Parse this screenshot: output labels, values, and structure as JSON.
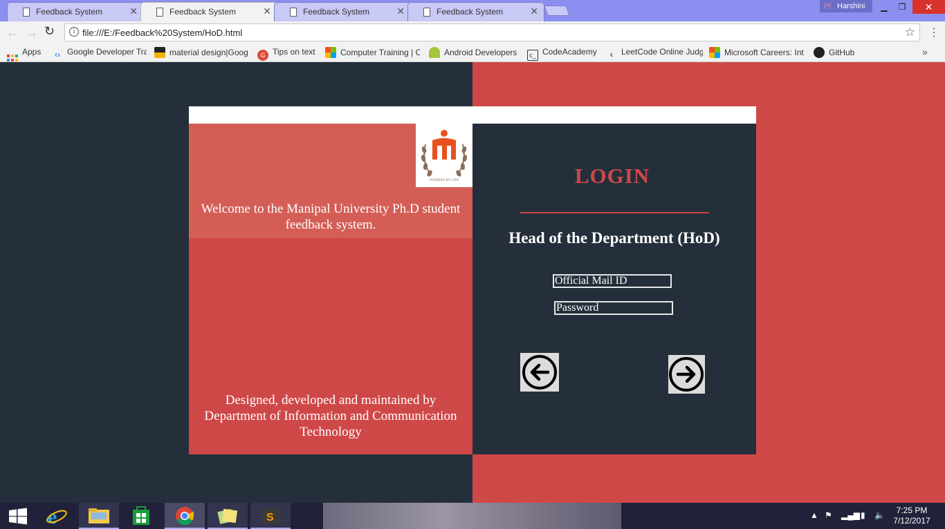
{
  "browser": {
    "tabs": [
      {
        "title": "Feedback System",
        "active": false
      },
      {
        "title": "Feedback System",
        "active": true
      },
      {
        "title": "Feedback System",
        "active": false
      },
      {
        "title": "Feedback System",
        "active": false
      }
    ],
    "profile_name": "Harshini",
    "url": "file:///E:/Feedback%20System/HoD.html",
    "bookmarks": [
      {
        "label": "Apps",
        "icon": "apps-grid-icon"
      },
      {
        "label": "Google Developer Tra",
        "icon": "google-developers-icon"
      },
      {
        "label": "material design|Goog",
        "icon": "material-design-icon"
      },
      {
        "label": "Tips on text",
        "icon": "google-plus-icon"
      },
      {
        "label": "Computer Training | C",
        "icon": "microsoft-icon"
      },
      {
        "label": "Android Developers",
        "icon": "android-icon"
      },
      {
        "label": "CodeAcademy",
        "icon": "codecademy-icon"
      },
      {
        "label": "LeetCode Online Judg",
        "icon": "leetcode-icon"
      },
      {
        "label": "Microsoft Careers: Int",
        "icon": "microsoft-icon"
      },
      {
        "label": "GitHub",
        "icon": "github-icon"
      }
    ]
  },
  "page": {
    "welcome": "Welcome to the Manipal University Ph.D student feedback system.",
    "footer": "Designed, developed and maintained by Department of Information and Communication Technology",
    "login_title": "LOGIN",
    "role": "Head of the Department (HoD)",
    "email_placeholder": "Official Mail ID",
    "password_placeholder": "Password",
    "logo_text": "INSPIRED BY LIFE",
    "colors": {
      "accent_red": "#cf4848",
      "navy": "#252f3b",
      "welcome_box": "#d45e56"
    }
  },
  "taskbar": {
    "time": "7:25 PM",
    "date": "7/12/2017"
  }
}
